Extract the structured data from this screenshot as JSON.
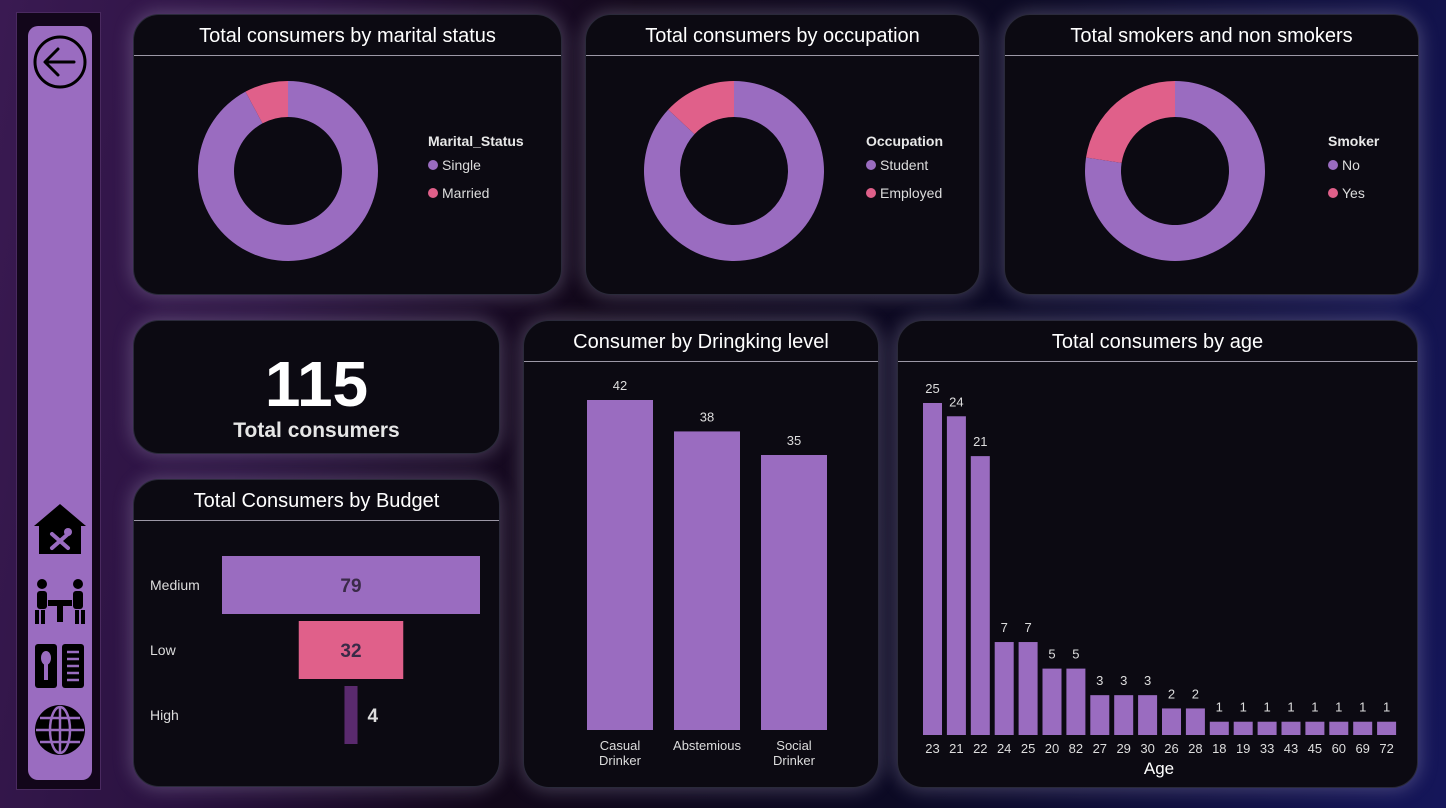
{
  "colors": {
    "primary": "#9a6cc0",
    "accent": "#e0608a",
    "dark": "#5a2a6e"
  },
  "sidebar": {
    "items": [
      {
        "name": "back-arrow-icon"
      },
      {
        "name": "restaurant-home-icon"
      },
      {
        "name": "dining-table-icon"
      },
      {
        "name": "menu-book-icon"
      },
      {
        "name": "globe-icon"
      }
    ]
  },
  "marital": {
    "title": "Total consumers by marital status",
    "legend_title": "Marital_Status",
    "slices": [
      {
        "label": "Single",
        "value": 106
      },
      {
        "label": "Married",
        "value": 9
      }
    ]
  },
  "occupation": {
    "title": "Total consumers by occupation",
    "legend_title": "Occupation",
    "slices": [
      {
        "label": "Student",
        "value": 100
      },
      {
        "label": "Employed",
        "value": 15
      }
    ]
  },
  "smoker": {
    "title": "Total smokers and non smokers",
    "legend_title": "Smoker",
    "slices": [
      {
        "label": "No",
        "value": 89
      },
      {
        "label": "Yes",
        "value": 26
      }
    ]
  },
  "kpi": {
    "value": "115",
    "label": "Total consumers"
  },
  "budget": {
    "title": "Total Consumers by Budget",
    "rows": [
      {
        "label": "Medium",
        "value": 79
      },
      {
        "label": "Low",
        "value": 32
      },
      {
        "label": "High",
        "value": 4
      }
    ]
  },
  "drinking": {
    "title": "Consumer by Dringking level",
    "bars": [
      {
        "label": [
          "Casual",
          "Drinker"
        ],
        "value": 42
      },
      {
        "label": [
          "Abstemious"
        ],
        "value": 38
      },
      {
        "label": [
          "Social",
          "Drinker"
        ],
        "value": 35
      }
    ]
  },
  "age": {
    "title": "Total consumers by age",
    "xlabel": "Age",
    "categories": [
      "23",
      "21",
      "22",
      "24",
      "25",
      "20",
      "82",
      "27",
      "29",
      "30",
      "26",
      "28",
      "18",
      "19",
      "33",
      "43",
      "45",
      "60",
      "69",
      "72"
    ],
    "values": [
      25,
      24,
      21,
      7,
      7,
      5,
      5,
      3,
      3,
      3,
      2,
      2,
      1,
      1,
      1,
      1,
      1,
      1,
      1,
      1
    ]
  },
  "chart_data": [
    {
      "type": "pie",
      "title": "Total consumers by marital status",
      "legend_title": "Marital_Status",
      "categories": [
        "Single",
        "Married"
      ],
      "values": [
        106,
        9
      ]
    },
    {
      "type": "pie",
      "title": "Total consumers by occupation",
      "legend_title": "Occupation",
      "categories": [
        "Student",
        "Employed"
      ],
      "values": [
        100,
        15
      ]
    },
    {
      "type": "pie",
      "title": "Total smokers and non smokers",
      "legend_title": "Smoker",
      "categories": [
        "No",
        "Yes"
      ],
      "values": [
        89,
        26
      ]
    },
    {
      "type": "bar",
      "title": "Total Consumers by Budget",
      "categories": [
        "Medium",
        "Low",
        "High"
      ],
      "values": [
        79,
        32,
        4
      ]
    },
    {
      "type": "bar",
      "title": "Consumer by Dringking level",
      "categories": [
        "Casual Drinker",
        "Abstemious",
        "Social Drinker"
      ],
      "values": [
        42,
        38,
        35
      ]
    },
    {
      "type": "bar",
      "title": "Total consumers by age",
      "xlabel": "Age",
      "categories": [
        "23",
        "21",
        "22",
        "24",
        "25",
        "20",
        "82",
        "27",
        "29",
        "30",
        "26",
        "28",
        "18",
        "19",
        "33",
        "43",
        "45",
        "60",
        "69",
        "72"
      ],
      "values": [
        25,
        24,
        21,
        7,
        7,
        5,
        5,
        3,
        3,
        3,
        2,
        2,
        1,
        1,
        1,
        1,
        1,
        1,
        1,
        1
      ]
    }
  ]
}
